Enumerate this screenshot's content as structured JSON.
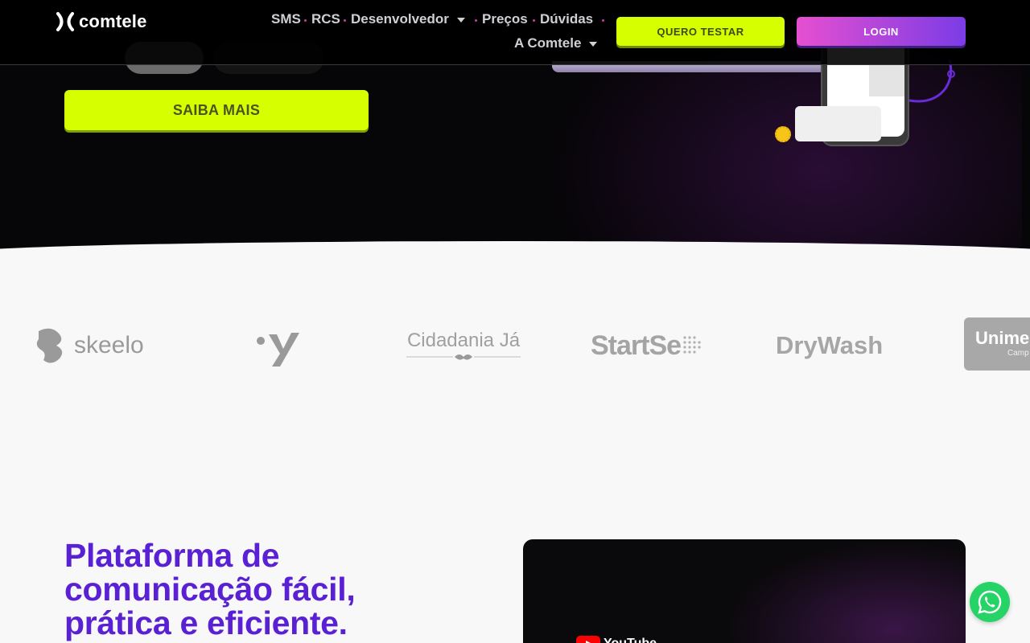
{
  "brand": {
    "name": "comtele",
    "accent": "#d6ff00",
    "purple": "#5a20d4"
  },
  "nav": {
    "items": [
      {
        "label": "SMS"
      },
      {
        "label": "RCS"
      },
      {
        "label": "Desenvolvedor"
      },
      {
        "label": "Preços"
      },
      {
        "label": "Dúvidas"
      },
      {
        "label": "A Comtele"
      }
    ],
    "cta_test": "QUERO TESTAR",
    "cta_login": "LOGIN"
  },
  "hero": {
    "cta_label": "SAIBA MAIS"
  },
  "clients": {
    "logos": [
      {
        "name": "skeelo",
        "icon": "skeelo-logo"
      },
      {
        "name": "y",
        "icon": "y-logo"
      },
      {
        "name": "Cidadania Já",
        "icon": "cidadania-logo"
      },
      {
        "name": "StartSe",
        "icon": "startse-logo"
      },
      {
        "name": "DryWash",
        "icon": "drywash-logo"
      },
      {
        "name": "Unime",
        "sub": "Camp",
        "icon": "unimed-logo"
      }
    ]
  },
  "section": {
    "headline": "Plataforma de comunicação fácil, prática e eficiente."
  },
  "video": {
    "platform": "YouTube"
  },
  "floating": {
    "icon": "whatsapp-icon"
  }
}
